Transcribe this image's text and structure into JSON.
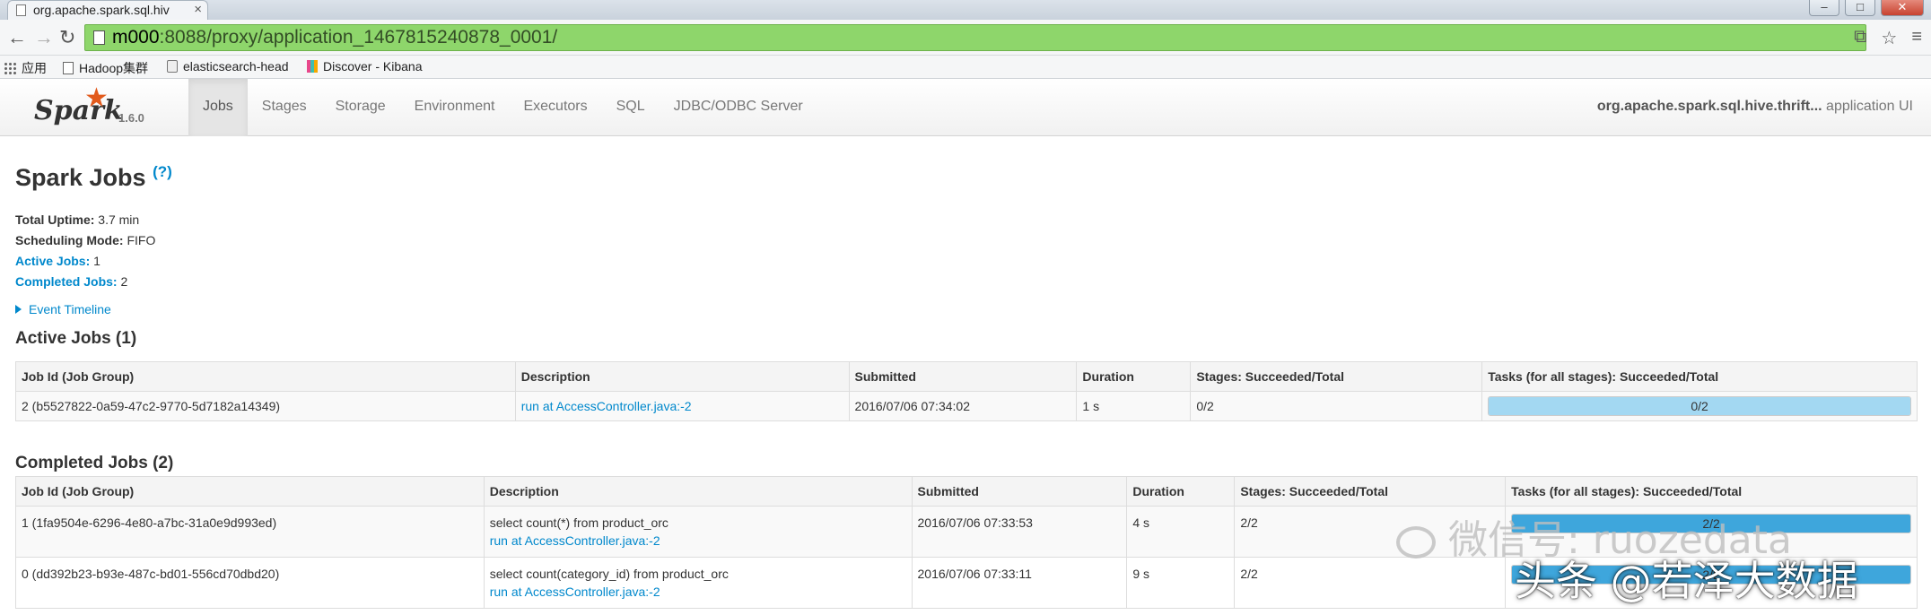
{
  "browser": {
    "tab_title": "org.apache.spark.sql.hiv",
    "tab_close": "×",
    "url_host": "m000",
    "url_rest": ":8088/proxy/application_1467815240878_0001/",
    "bookmarks": [
      "应用",
      "Hadoop集群",
      "elasticsearch-head",
      "Discover - Kibana"
    ]
  },
  "spark_nav": {
    "logo_text": "Spark",
    "version": "1.6.0",
    "tabs": [
      "Jobs",
      "Stages",
      "Storage",
      "Environment",
      "Executors",
      "SQL",
      "JDBC/ODBC Server"
    ],
    "active_tab": "Jobs",
    "app_name": "org.apache.spark.sql.hive.thrift...",
    "app_suffix": "application UI"
  },
  "page": {
    "title": "Spark Jobs",
    "help": "(?)",
    "total_uptime_label": "Total Uptime:",
    "total_uptime": "3.7 min",
    "scheduling_mode_label": "Scheduling Mode:",
    "scheduling_mode": "FIFO",
    "active_jobs_label": "Active Jobs:",
    "active_jobs": "1",
    "completed_jobs_label": "Completed Jobs:",
    "completed_jobs": "2",
    "event_timeline": "Event Timeline"
  },
  "active_jobs": {
    "title": "Active Jobs (1)",
    "headers": [
      "Job Id (Job Group)",
      "Description",
      "Submitted",
      "Duration",
      "Stages: Succeeded/Total",
      "Tasks (for all stages): Succeeded/Total"
    ],
    "rows": [
      {
        "job_id": "2 (b5527822-0a59-47c2-9770-5d7182a14349)",
        "description": "run at AccessController.java:-2",
        "submitted": "2016/07/06 07:34:02",
        "duration": "1 s",
        "stages": "0/2",
        "tasks": "0/2",
        "tasks_progress": 0.0,
        "tasks_running": 1.0
      }
    ]
  },
  "completed_jobs": {
    "title": "Completed Jobs (2)",
    "headers": [
      "Job Id (Job Group)",
      "Description",
      "Submitted",
      "Duration",
      "Stages: Succeeded/Total",
      "Tasks (for all stages): Succeeded/Total"
    ],
    "rows": [
      {
        "job_id": "1 (1fa9504e-6296-4e80-a7bc-31a0e9d993ed)",
        "description": "select count(*) from product_orc",
        "description_link": "run at AccessController.java:-2",
        "submitted": "2016/07/06 07:33:53",
        "duration": "4 s",
        "stages": "2/2",
        "tasks": "2/2",
        "tasks_progress": 1.0
      },
      {
        "job_id": "0 (dd392b23-b93e-487c-bd01-556cd70dbd20)",
        "description": "select count(category_id) from product_orc",
        "description_link": "run at AccessController.java:-2",
        "submitted": "2016/07/06 07:33:11",
        "duration": "9 s",
        "stages": "2/2",
        "tasks": "2/2",
        "tasks_progress": 1.0
      }
    ]
  },
  "watermarks": {
    "wechat": "微信号: ruozedata",
    "toutiao": "头条 @若泽大数据"
  },
  "colors": {
    "link": "#0088cc",
    "url_bar": "#8ed66b",
    "progress_running": "#a3d8f2",
    "progress_done": "#3ea6dc"
  }
}
